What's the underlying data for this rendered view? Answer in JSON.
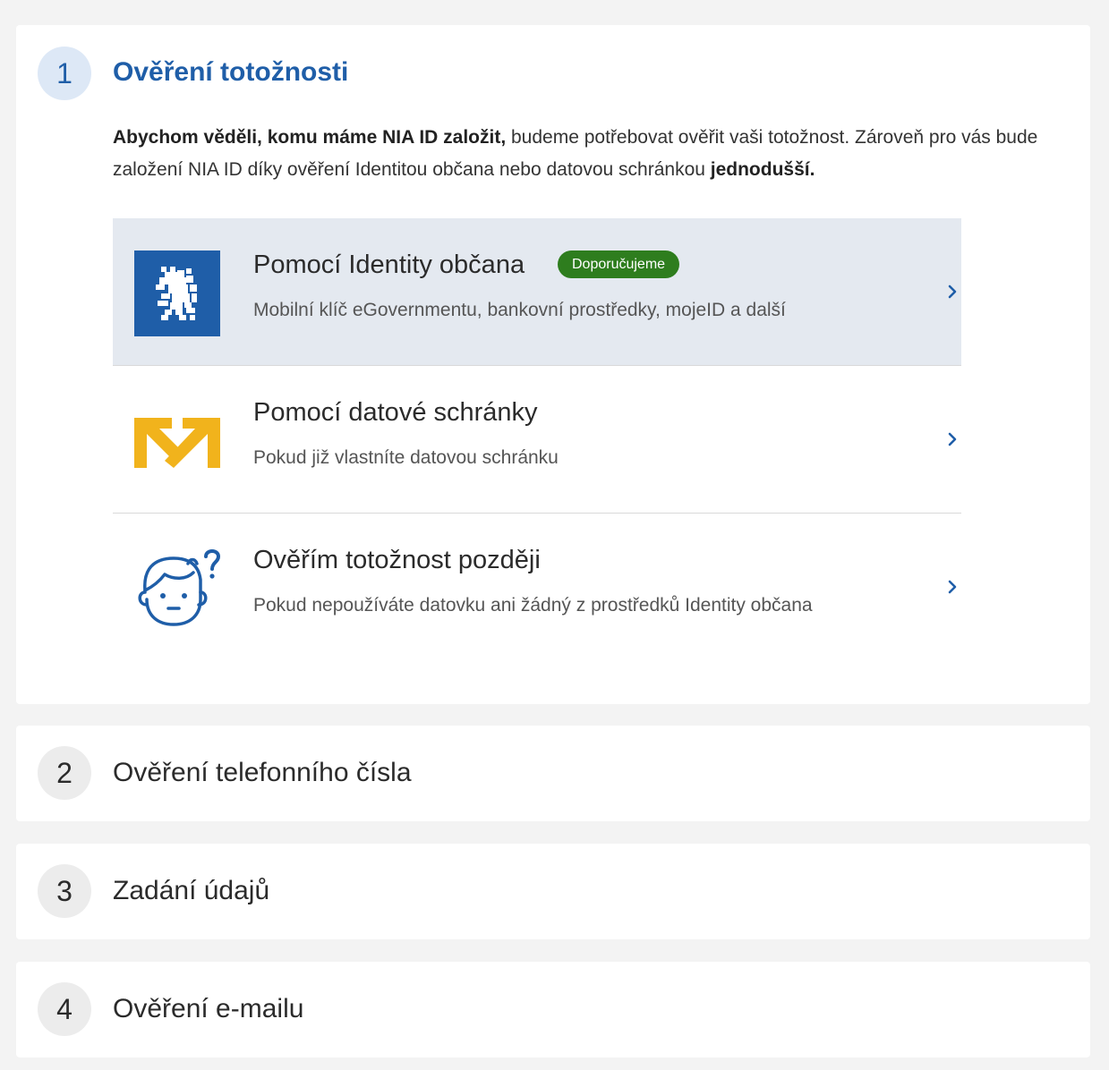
{
  "colors": {
    "accent": "#1f5ea8",
    "badge_green": "#2e7d1e",
    "highlight_bg": "#e4e9f0",
    "databox_yellow": "#f1b31c"
  },
  "step1": {
    "number": "1",
    "title": "Ověření totožnosti",
    "intro_bold_1": "Abychom věděli, komu máme NIA ID založit,",
    "intro_text_1": " budeme potřebovat ověřit vaši totožnost. Zároveň pro vás bude založení NIA ID díky ověření Identitou občana nebo datovou schránkou ",
    "intro_bold_2": "jednodušší.",
    "options": [
      {
        "title": "Pomocí Identity občana",
        "badge": "Doporučujeme",
        "subtitle": "Mobilní klíč eGovernmentu, bankovní prostředky, mojeID a další",
        "icon": "czech-lion-icon"
      },
      {
        "title": "Pomocí datové schránky",
        "subtitle": "Pokud již vlastníte datovou schránku",
        "icon": "databox-icon"
      },
      {
        "title": "Ověřím totožnost později",
        "subtitle": "Pokud nepoužíváte datovku ani žádný z prostředků Identity občana",
        "icon": "person-question-icon"
      }
    ]
  },
  "steps": [
    {
      "number": "2",
      "title": "Ověření telefonního čísla"
    },
    {
      "number": "3",
      "title": "Zadání údajů"
    },
    {
      "number": "4",
      "title": "Ověření e-mailu"
    }
  ]
}
